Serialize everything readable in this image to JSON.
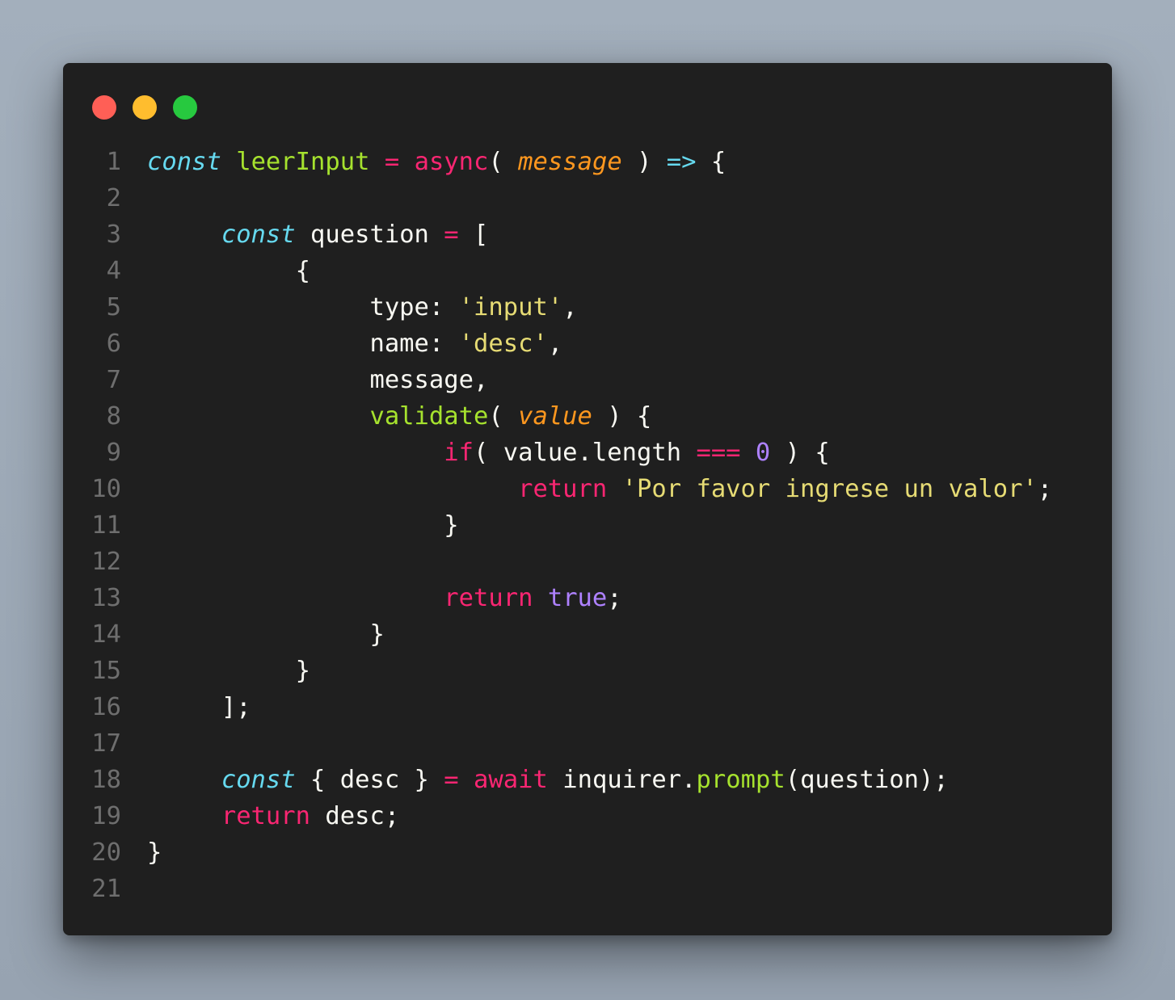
{
  "window": {
    "controls": [
      {
        "name": "close-dot",
        "color": "#ff5f56"
      },
      {
        "name": "minimize-dot",
        "color": "#ffbd2e"
      },
      {
        "name": "maximize-dot",
        "color": "#27c93f"
      }
    ]
  },
  "theme": {
    "background": "#1f1f1f",
    "storage": "#66d9ef",
    "function": "#a6e22e",
    "keyword": "#f92672",
    "parameter": "#fd971f",
    "string": "#e6db74",
    "number": "#ae81ff",
    "plain": "#f8f8f2",
    "line_number": "#6e6e6e"
  },
  "code": {
    "lines": [
      {
        "n": "1",
        "indent": "",
        "tokens": [
          {
            "t": "const",
            "c": "storage",
            "s": "italic"
          },
          {
            "t": " "
          },
          {
            "t": "leerInput",
            "c": "function"
          },
          {
            "t": " "
          },
          {
            "t": "=",
            "c": "keyword"
          },
          {
            "t": " "
          },
          {
            "t": "async",
            "c": "keyword"
          },
          {
            "t": "( "
          },
          {
            "t": "message",
            "c": "parameter",
            "s": "italic"
          },
          {
            "t": " ) "
          },
          {
            "t": "=>",
            "c": "storage"
          },
          {
            "t": " {"
          }
        ]
      },
      {
        "n": "2",
        "indent": "",
        "tokens": []
      },
      {
        "n": "3",
        "indent": "     ",
        "tokens": [
          {
            "t": "const",
            "c": "storage",
            "s": "italic"
          },
          {
            "t": " question "
          },
          {
            "t": "=",
            "c": "keyword"
          },
          {
            "t": " ["
          }
        ]
      },
      {
        "n": "4",
        "indent": "          ",
        "tokens": [
          {
            "t": "{"
          }
        ]
      },
      {
        "n": "5",
        "indent": "               ",
        "tokens": [
          {
            "t": "type: "
          },
          {
            "t": "'input'",
            "c": "string"
          },
          {
            "t": ","
          }
        ]
      },
      {
        "n": "6",
        "indent": "               ",
        "tokens": [
          {
            "t": "name: "
          },
          {
            "t": "'desc'",
            "c": "string"
          },
          {
            "t": ","
          }
        ]
      },
      {
        "n": "7",
        "indent": "               ",
        "tokens": [
          {
            "t": "message,"
          }
        ]
      },
      {
        "n": "8",
        "indent": "               ",
        "tokens": [
          {
            "t": "validate",
            "c": "function"
          },
          {
            "t": "( "
          },
          {
            "t": "value",
            "c": "parameter",
            "s": "italic"
          },
          {
            "t": " ) {"
          }
        ]
      },
      {
        "n": "9",
        "indent": "                    ",
        "tokens": [
          {
            "t": "if",
            "c": "keyword"
          },
          {
            "t": "( value.length "
          },
          {
            "t": "===",
            "c": "keyword"
          },
          {
            "t": " "
          },
          {
            "t": "0",
            "c": "number"
          },
          {
            "t": " ) {"
          }
        ]
      },
      {
        "n": "10",
        "indent": "                         ",
        "tokens": [
          {
            "t": "return",
            "c": "keyword"
          },
          {
            "t": " "
          },
          {
            "t": "'Por favor ingrese un valor'",
            "c": "string"
          },
          {
            "t": ";"
          }
        ]
      },
      {
        "n": "11",
        "indent": "                    ",
        "tokens": [
          {
            "t": "}"
          }
        ]
      },
      {
        "n": "12",
        "indent": "",
        "tokens": []
      },
      {
        "n": "13",
        "indent": "                    ",
        "tokens": [
          {
            "t": "return",
            "c": "keyword"
          },
          {
            "t": " "
          },
          {
            "t": "true",
            "c": "number"
          },
          {
            "t": ";"
          }
        ]
      },
      {
        "n": "14",
        "indent": "               ",
        "tokens": [
          {
            "t": "}"
          }
        ]
      },
      {
        "n": "15",
        "indent": "          ",
        "tokens": [
          {
            "t": "}"
          }
        ]
      },
      {
        "n": "16",
        "indent": "     ",
        "tokens": [
          {
            "t": "];"
          }
        ]
      },
      {
        "n": "17",
        "indent": "",
        "tokens": []
      },
      {
        "n": "18",
        "indent": "     ",
        "tokens": [
          {
            "t": "const",
            "c": "storage",
            "s": "italic"
          },
          {
            "t": " { desc } "
          },
          {
            "t": "=",
            "c": "keyword"
          },
          {
            "t": " "
          },
          {
            "t": "await",
            "c": "keyword"
          },
          {
            "t": " inquirer."
          },
          {
            "t": "prompt",
            "c": "function"
          },
          {
            "t": "(question);"
          }
        ]
      },
      {
        "n": "19",
        "indent": "     ",
        "tokens": [
          {
            "t": "return",
            "c": "keyword"
          },
          {
            "t": " desc;"
          }
        ]
      },
      {
        "n": "20",
        "indent": "",
        "tokens": [
          {
            "t": "}"
          }
        ]
      },
      {
        "n": "21",
        "indent": "",
        "tokens": []
      }
    ]
  }
}
